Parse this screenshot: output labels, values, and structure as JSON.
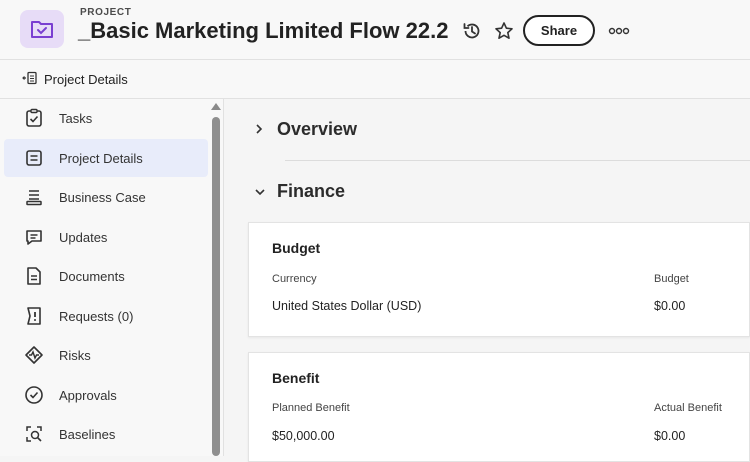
{
  "header": {
    "project_label": "PROJECT",
    "title": "_Basic Marketing Limited Flow 22.2",
    "share_label": "Share",
    "icons": [
      "folder-check-icon",
      "history-icon",
      "star-icon",
      "more-icon"
    ]
  },
  "breadcrumb": {
    "label": "Project Details",
    "icon": "panel-toggle-icon"
  },
  "sidebar": {
    "items": [
      {
        "label": "Tasks",
        "icon": "tasks-icon",
        "active": false
      },
      {
        "label": "Project Details",
        "icon": "details-icon",
        "active": true
      },
      {
        "label": "Business Case",
        "icon": "business-case-icon",
        "active": false
      },
      {
        "label": "Updates",
        "icon": "updates-icon",
        "active": false
      },
      {
        "label": "Documents",
        "icon": "documents-icon",
        "active": false
      },
      {
        "label": "Requests (0)",
        "icon": "requests-icon",
        "active": false
      },
      {
        "label": "Risks",
        "icon": "risks-icon",
        "active": false
      },
      {
        "label": "Approvals",
        "icon": "approvals-icon",
        "active": false
      },
      {
        "label": "Baselines",
        "icon": "baselines-icon",
        "active": false
      }
    ]
  },
  "main": {
    "overview": {
      "title": "Overview",
      "expanded": false
    },
    "finance": {
      "title": "Finance",
      "expanded": true
    },
    "budget_card": {
      "title": "Budget",
      "currency_label": "Currency",
      "currency_value": "United States Dollar (USD)",
      "budget_label": "Budget",
      "budget_value": "$0.00"
    },
    "benefit_card": {
      "title": "Benefit",
      "planned_label": "Planned Benefit",
      "planned_value": "$50,000.00",
      "actual_label": "Actual Benefit",
      "actual_value": "$0.00"
    }
  },
  "colors": {
    "icon_bg": "#e7dcf7",
    "icon_fg": "#7a3fd1",
    "active_bg": "#e8ecfa"
  }
}
